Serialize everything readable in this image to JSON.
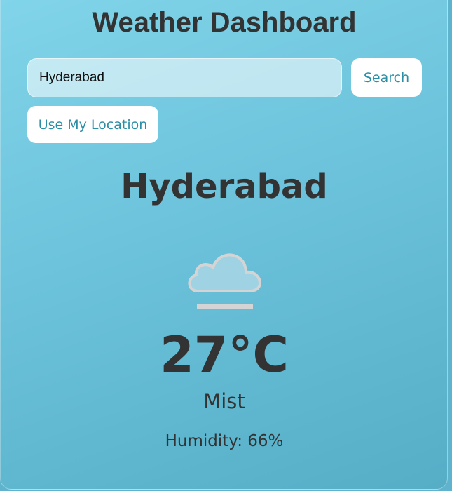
{
  "header": {
    "title": "Weather Dashboard"
  },
  "search": {
    "value": "Hyderabad",
    "button_label": "Search",
    "location_button_label": "Use My Location"
  },
  "weather": {
    "city": "Hyderabad",
    "icon": "mist-cloud-icon",
    "temperature": "27°C",
    "description": "Mist",
    "humidity": "Humidity: 66%"
  },
  "colors": {
    "text": "#333333",
    "button_text": "#2a8fa6",
    "background_start": "#82d5ea",
    "background_end": "#55adc6"
  }
}
